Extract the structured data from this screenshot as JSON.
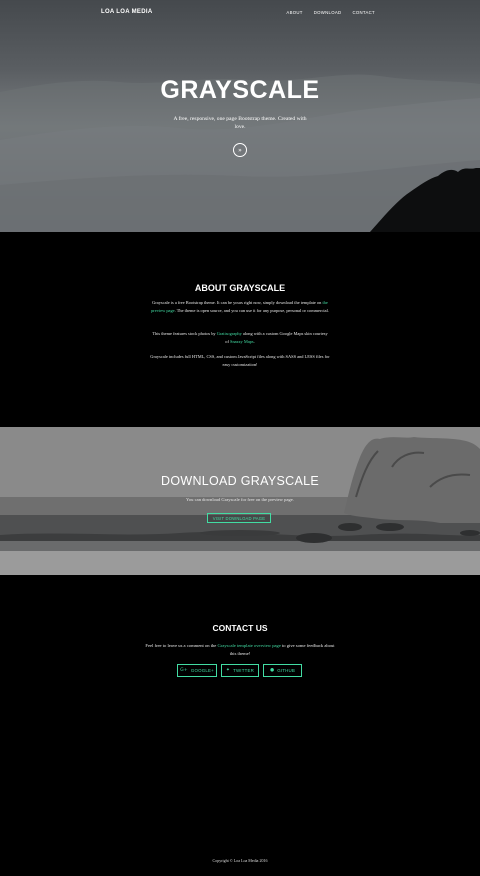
{
  "nav": {
    "brand": "LOA LOA MEDIA",
    "links": [
      "ABOUT",
      "DOWNLOAD",
      "CONTACT"
    ]
  },
  "hero": {
    "title": "GRAYSCALE",
    "subtitle": "A free, responsive, one page Bootstrap theme. Created with love.",
    "scroll_icon": "double-chevron-down-icon"
  },
  "about": {
    "title": "ABOUT GRAYSCALE",
    "p1_a": "Grayscale is a free Bootstrap theme. It can be yours right now, simply download the template on ",
    "p1_link": "the preview page",
    "p1_b": ". The theme is open source, and you can use it for any purpose, personal or commercial.",
    "p2_a": "This theme features stock photos by ",
    "p2_link1": "Gratisography",
    "p2_b": " along with a custom Google Maps skin courtesy of ",
    "p2_link2": "Snazzy Maps",
    "p2_c": ".",
    "p3": "Grayscale includes full HTML, CSS, and custom JavaScript files along with SASS and LESS files for easy customization!"
  },
  "download": {
    "title": "DOWNLOAD GRAYSCALE",
    "text": "You can download Grayscale for free on the preview page.",
    "button": "VISIT DOWNLOAD PAGE"
  },
  "contact": {
    "title": "CONTACT US",
    "text_a": "Feel free to leave us a comment on the ",
    "text_link": "Grayscale template overview page",
    "text_b": " to give some feedback about this theme!",
    "buttons": [
      {
        "label": "GOOGLE+",
        "icon": "google-plus-icon"
      },
      {
        "label": "TWITTER",
        "icon": "twitter-icon"
      },
      {
        "label": "GITHUB",
        "icon": "github-icon"
      }
    ]
  },
  "footer": {
    "copyright": "Copyright © Loa Loa Media 2016"
  },
  "colors": {
    "accent": "#42dca3",
    "background": "#000000"
  }
}
